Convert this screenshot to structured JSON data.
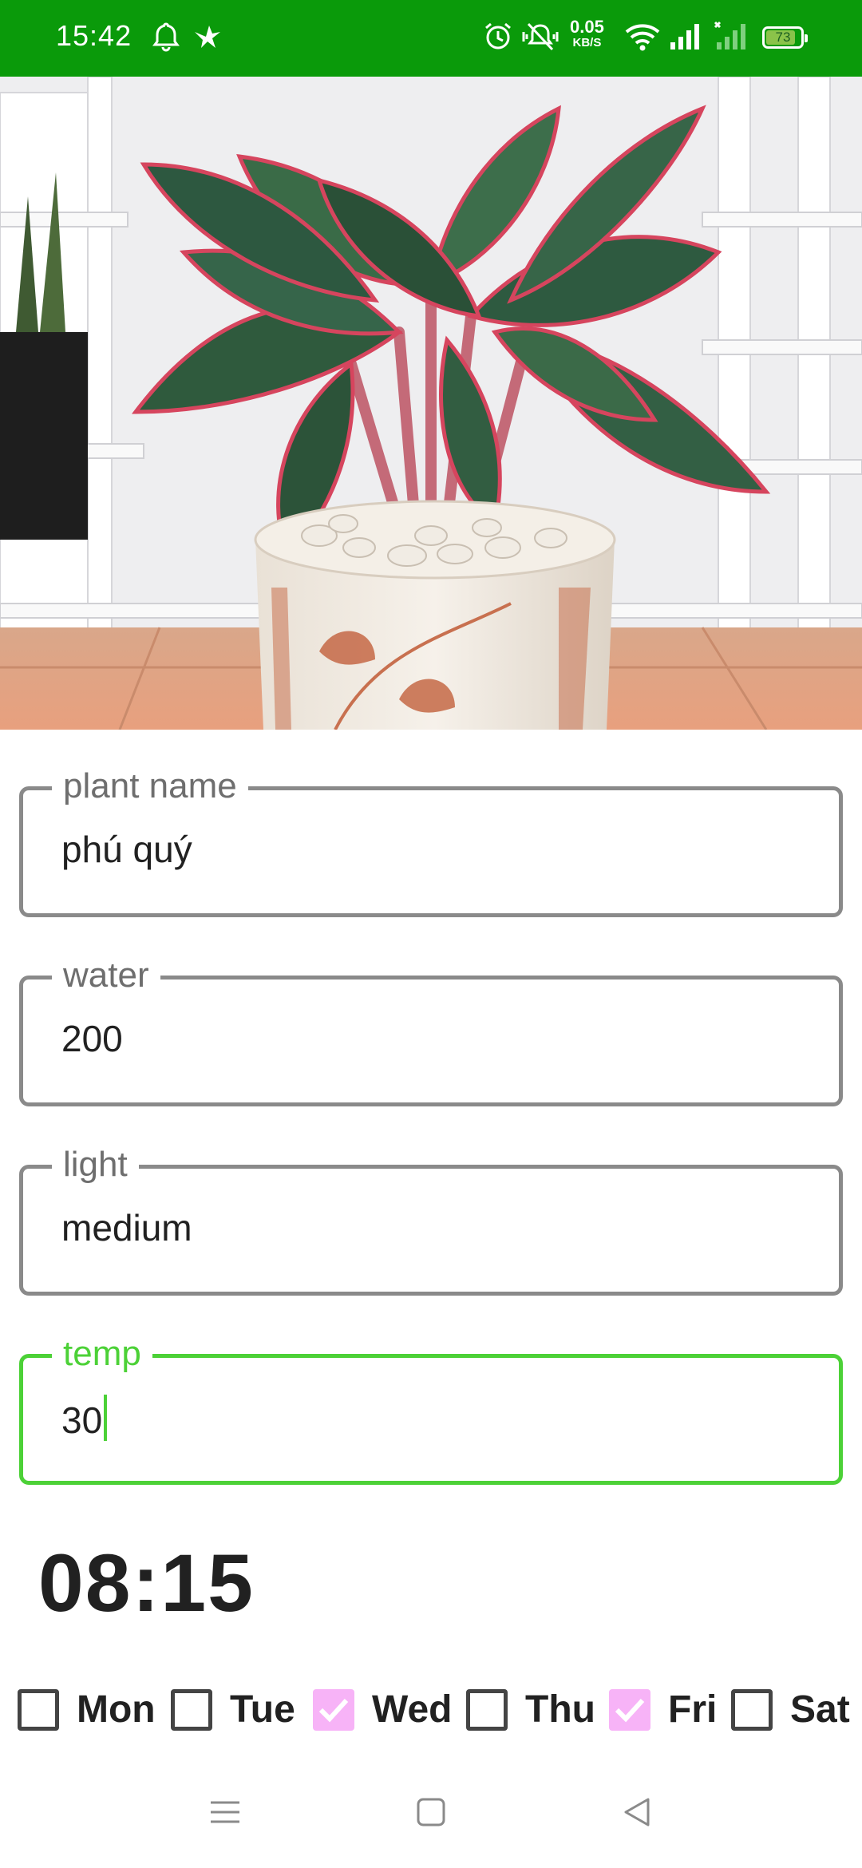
{
  "status_bar": {
    "time": "15:42",
    "network_speed_value": "0.05",
    "network_speed_unit": "KB/S",
    "battery": "73",
    "icons": [
      "bell-icon",
      "bird-icon",
      "alarm-icon",
      "vibrate-icon",
      "wifi-icon",
      "signal-icon",
      "signal-no-service-icon",
      "battery-icon"
    ]
  },
  "hero": {
    "subject": "plant-photo"
  },
  "fields": {
    "plant_name": {
      "label": "plant name",
      "value": "phú quý"
    },
    "water": {
      "label": "water",
      "value": "200"
    },
    "light": {
      "label": "light",
      "value": "medium"
    },
    "temp": {
      "label": "temp",
      "value": "30"
    }
  },
  "alarm_time": "08:15",
  "days": [
    {
      "label": "Mon",
      "checked": false
    },
    {
      "label": "Tue",
      "checked": false
    },
    {
      "label": "Wed",
      "checked": true
    },
    {
      "label": "Thu",
      "checked": false
    },
    {
      "label": "Fri",
      "checked": true
    },
    {
      "label": "Sat",
      "checked": false
    }
  ],
  "colors": {
    "status_bar": "#0a9a0a",
    "focus_accent": "#4cd137",
    "checkbox_checked": "#f7b3f7"
  },
  "nav": [
    "menu-icon",
    "home-icon",
    "back-icon"
  ]
}
